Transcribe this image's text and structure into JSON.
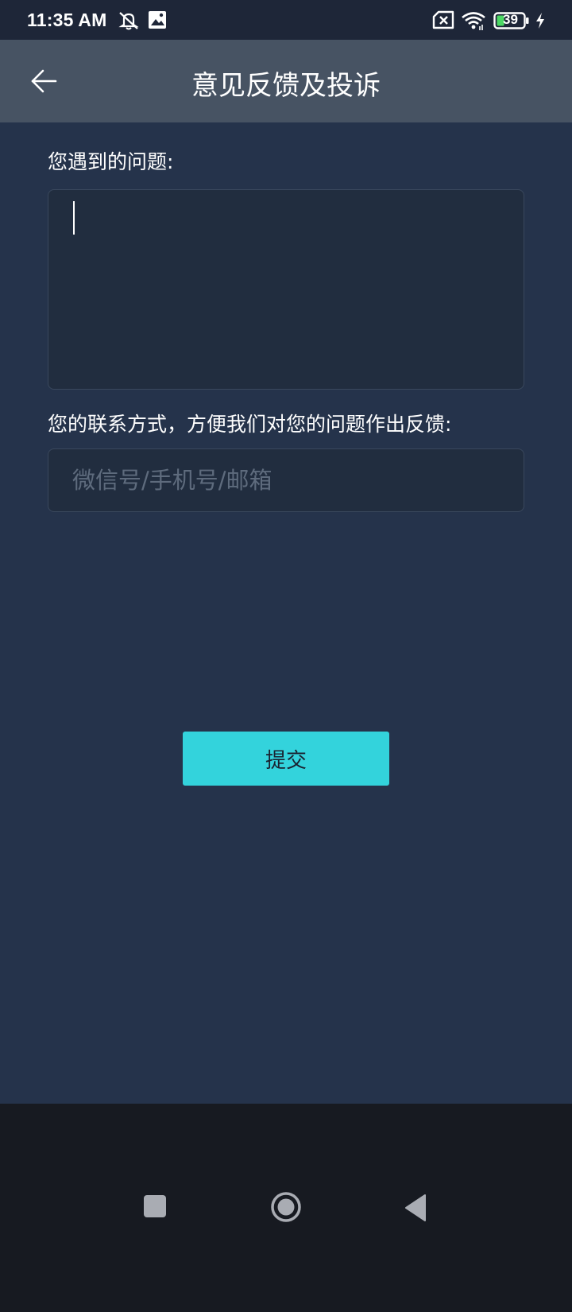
{
  "status_bar": {
    "time": "11:35 AM",
    "battery_level": "39",
    "icons": [
      "mute-icon",
      "image-icon",
      "sim-disabled-icon",
      "wifi-icon",
      "battery-icon",
      "charging-icon"
    ]
  },
  "app_bar": {
    "title": "意见反馈及投诉",
    "back_icon": "arrow-left-icon"
  },
  "form": {
    "problem_label": "您遇到的问题:",
    "problem_value": "",
    "contact_label": "您的联系方式，方便我们对您的问题作出反馈:",
    "contact_placeholder": "微信号/手机号/邮箱",
    "contact_value": "",
    "submit_label": "提交"
  },
  "colors": {
    "status_bar_bg": "#1e2638",
    "app_bar_bg": "#475363",
    "content_bg": "#25334b",
    "input_bg": "#212d3f",
    "accent": "#33d3dc",
    "nav_bar_bg": "#171a21"
  },
  "nav_bar": {
    "buttons": [
      "recents-square-icon",
      "home-circle-icon",
      "back-triangle-icon"
    ]
  }
}
